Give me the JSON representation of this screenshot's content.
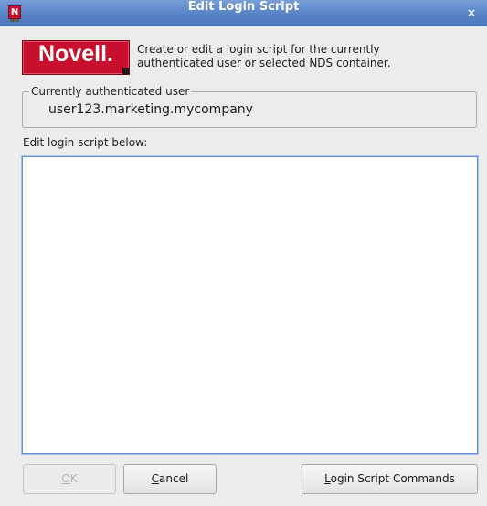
{
  "window": {
    "title": "Edit Login Script",
    "close_glyph": "×",
    "app_icon_letter": "N"
  },
  "logo": {
    "text": "Novell."
  },
  "intro": {
    "line1": "Create or edit a login script for the currently",
    "line2": "authenticated user or selected NDS container."
  },
  "current_user": {
    "legend": "Currently authenticated user",
    "value": "user123.marketing.mycompany"
  },
  "script": {
    "label": "Edit login script below:",
    "value": ""
  },
  "buttons": {
    "ok": {
      "mnemonic": "O",
      "rest": "K",
      "enabled": false
    },
    "cancel": {
      "mnemonic": "C",
      "rest": "ancel"
    },
    "commands": {
      "mnemonic": "L",
      "rest": "ogin Script Commands"
    }
  },
  "colors": {
    "titlebar": "#5c87c9",
    "logo_red": "#c8102e",
    "dialog_bg": "#ececec",
    "focus_border": "#6a91cf"
  }
}
